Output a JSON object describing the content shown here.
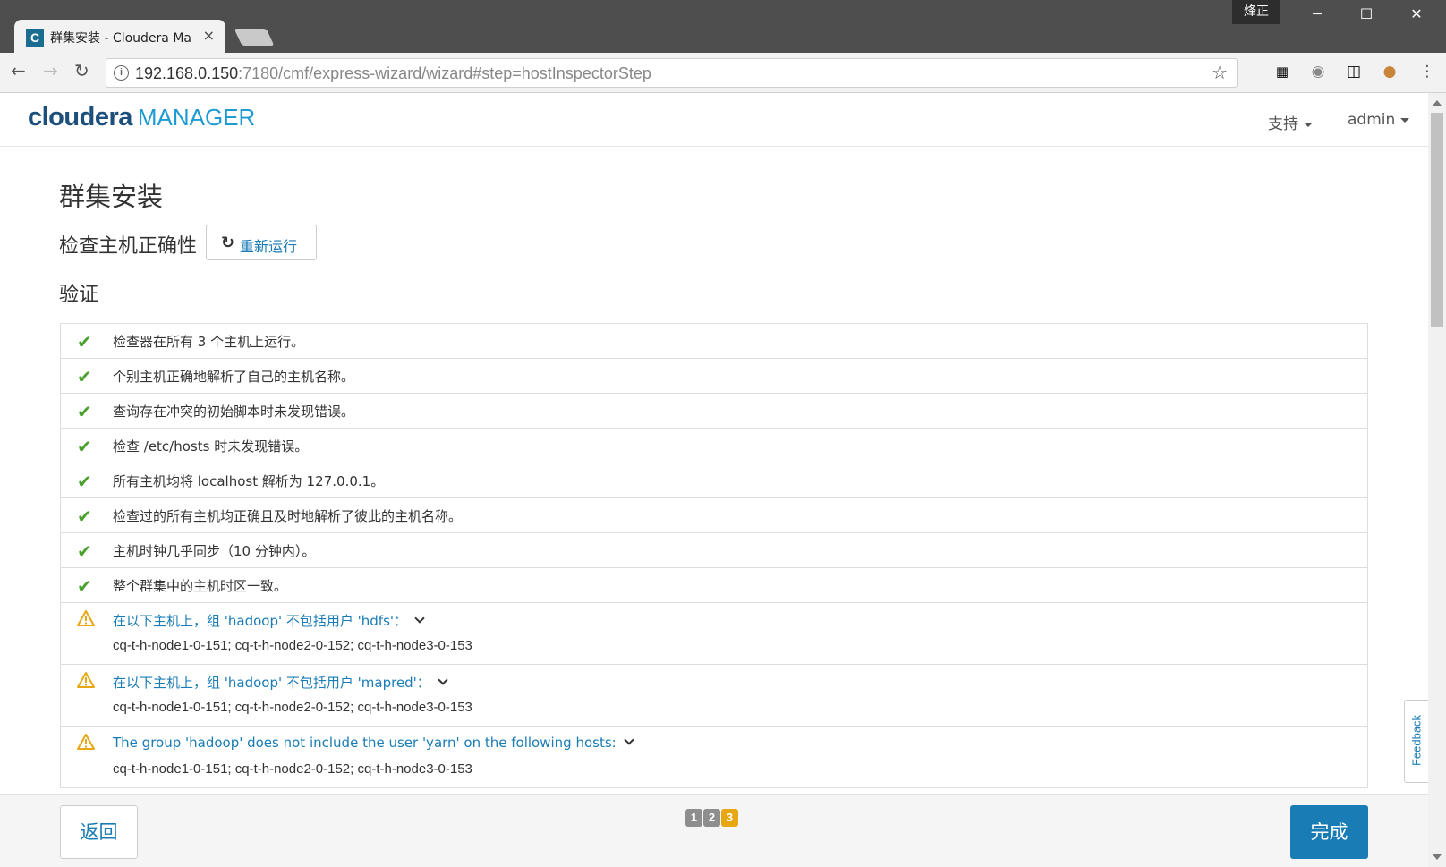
{
  "browser": {
    "tab_title": "群集安装 - Cloudera Ma",
    "tab_close": "×",
    "user_badge": "烽正",
    "window_controls": {
      "minimize": "─",
      "maximize": "☐",
      "close": "✕"
    },
    "url_host": "192.168.0.150",
    "url_path": ":7180/cmf/express-wizard/wizard#step=hostInspectorStep",
    "extensions": [
      "qr-code-icon",
      "globe-icon",
      "incognito-icon",
      "cookie-icon"
    ]
  },
  "header": {
    "brand": "cloudera",
    "product": "MANAGER",
    "support_menu": "支持",
    "user_menu": "admin"
  },
  "content": {
    "page_title": "群集安装",
    "section_title": "检查主机正确性",
    "rerun_label": "重新运行",
    "sub_title": "验证",
    "checks": [
      {
        "status": "ok",
        "text": "检查器在所有 3 个主机上运行。"
      },
      {
        "status": "ok",
        "text": "个别主机正确地解析了自己的主机名称。"
      },
      {
        "status": "ok",
        "text": "查询存在冲突的初始脚本时未发现错误。"
      },
      {
        "status": "ok",
        "text": "检查 /etc/hosts 时未发现错误。"
      },
      {
        "status": "ok",
        "text": "所有主机均将 localhost 解析为 127.0.0.1。"
      },
      {
        "status": "ok",
        "text": "检查过的所有主机均正确且及时地解析了彼此的主机名称。"
      },
      {
        "status": "ok",
        "text": "主机时钟几乎同步（10 分钟内）。"
      },
      {
        "status": "ok",
        "text": "整个群集中的主机时区一致。"
      },
      {
        "status": "warn",
        "text": "在以下主机上，组 'hadoop' 不包括用户 'hdfs'：",
        "hosts": "cq-t-h-node1-0-151; cq-t-h-node2-0-152; cq-t-h-node3-0-153"
      },
      {
        "status": "warn",
        "text": "在以下主机上，组 'hadoop' 不包括用户 'mapred'：",
        "hosts": "cq-t-h-node1-0-151; cq-t-h-node2-0-152; cq-t-h-node3-0-153"
      },
      {
        "status": "warn",
        "text": "The group 'hadoop' does not include the user 'yarn' on the following hosts:",
        "hosts": "cq-t-h-node1-0-151; cq-t-h-node2-0-152; cq-t-h-node3-0-153"
      }
    ]
  },
  "footer": {
    "back_label": "返回",
    "steps": [
      "1",
      "2",
      "3"
    ],
    "current_step": 3,
    "finish_label": "完成",
    "feedback_label": "Feedback"
  },
  "colors": {
    "accent": "#1a7cb5",
    "ok": "#4aa02c",
    "warn": "#e7a713",
    "brand": "#1d4f7c"
  }
}
